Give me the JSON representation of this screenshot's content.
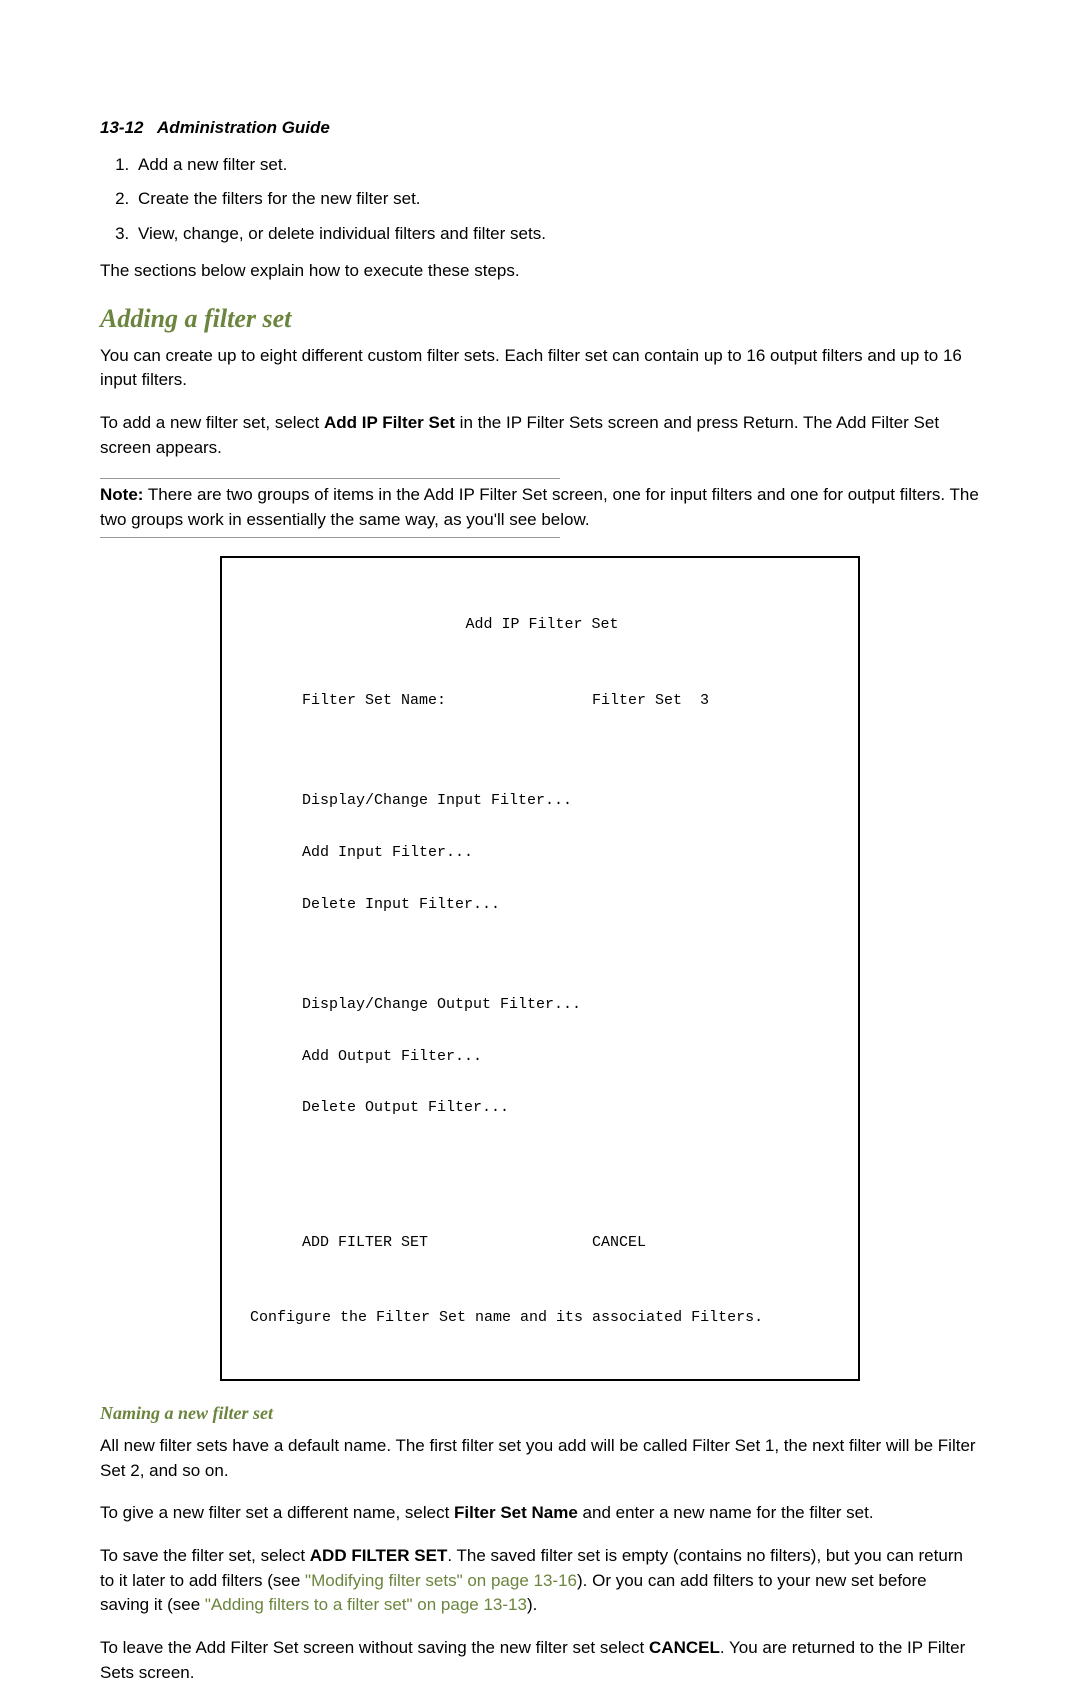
{
  "header": {
    "page_number": "13-12",
    "title": "Administration Guide"
  },
  "steps": [
    "Add a new filter set.",
    "Create the filters for the new filter set.",
    "View, change, or delete individual filters and filter sets."
  ],
  "intro_line": "The sections below explain how to execute these steps.",
  "section_heading": "Adding a filter set",
  "para1": "You can create up to eight different custom filter sets. Each filter set can contain up to 16 output filters and up to 16 input filters.",
  "para2_pre": "To add a new filter set, select ",
  "para2_bold": "Add IP Filter Set",
  "para2_post": " in the IP Filter Sets screen and press Return. The Add Filter Set screen appears.",
  "note_label": "Note:",
  "note_body": " There are two groups of items in the Add IP Filter Set screen, one for input filters and one for output filters. The two groups work in essentially the same way, as you'll see below.",
  "terminal": {
    "title": "Add IP Filter Set",
    "field_label": "Filter Set Name:",
    "field_value": "Filter Set  3",
    "input_items": [
      "Display/Change Input Filter...",
      "Add Input Filter...",
      "Delete Input Filter..."
    ],
    "output_items": [
      "Display/Change Output Filter...",
      "Add Output Filter...",
      "Delete Output Filter..."
    ],
    "action_add": "ADD FILTER SET",
    "action_cancel": "CANCEL",
    "hint": "Configure the Filter Set name and its associated Filters."
  },
  "sub_heading": "Naming a new filter set",
  "para3": "All new filter sets have a default name. The first filter set you add will be called Filter Set 1, the next filter will be Filter Set 2, and so on.",
  "para4_pre": "To give a new filter set a different name, select ",
  "para4_bold": "Filter Set Name",
  "para4_post": " and enter a new name for the filter set.",
  "para5_pre": "To save the filter set, select ",
  "para5_bold": "ADD FILTER SET",
  "para5_mid": ". The saved filter set is empty (contains no filters), but you can return to it later to add filters (see ",
  "link1": "\"Modifying filter sets\" on page 13-16",
  "para5_mid2": "). Or you can add filters to your new set before saving it (see ",
  "link2": "\"Adding filters to a filter set\" on page 13-13",
  "para5_end": ").",
  "para6_pre": "To leave the Add Filter Set screen without saving the new filter set select ",
  "para6_bold": "CANCEL",
  "para6_post": ". You are returned to the IP Filter Sets screen."
}
